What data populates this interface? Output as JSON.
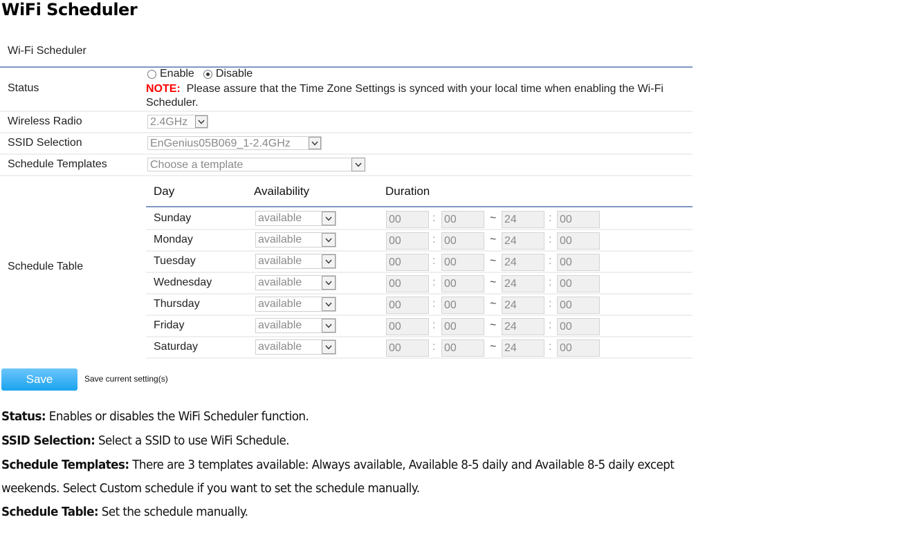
{
  "doc_title": "WiFi Scheduler",
  "panel": {
    "title": "Wi-Fi Scheduler",
    "status": {
      "label": "Status",
      "options": [
        {
          "label": "Enable",
          "checked": false
        },
        {
          "label": "Disable",
          "checked": true
        }
      ],
      "note_key": "NOTE:",
      "note_text": "Please assure that the Time Zone Settings is synced with your local time when enabling the Wi-Fi Scheduler."
    },
    "wireless_radio": {
      "label": "Wireless Radio",
      "value": "2.4GHz"
    },
    "ssid_selection": {
      "label": "SSID Selection",
      "value": "EnGenius05B069_1-2.4GHz"
    },
    "schedule_templates": {
      "label": "Schedule Templates",
      "value": "Choose a template"
    },
    "schedule_table": {
      "label": "Schedule Table",
      "headers": {
        "day": "Day",
        "availability": "Availability",
        "duration": "Duration"
      },
      "rows": [
        {
          "day": "Sunday",
          "availability": "available",
          "start_h": "00",
          "start_m": "00",
          "end_h": "24",
          "end_m": "00"
        },
        {
          "day": "Monday",
          "availability": "available",
          "start_h": "00",
          "start_m": "00",
          "end_h": "24",
          "end_m": "00"
        },
        {
          "day": "Tuesday",
          "availability": "available",
          "start_h": "00",
          "start_m": "00",
          "end_h": "24",
          "end_m": "00"
        },
        {
          "day": "Wednesday",
          "availability": "available",
          "start_h": "00",
          "start_m": "00",
          "end_h": "24",
          "end_m": "00"
        },
        {
          "day": "Thursday",
          "availability": "available",
          "start_h": "00",
          "start_m": "00",
          "end_h": "24",
          "end_m": "00"
        },
        {
          "day": "Friday",
          "availability": "available",
          "start_h": "00",
          "start_m": "00",
          "end_h": "24",
          "end_m": "00"
        },
        {
          "day": "Saturday",
          "availability": "available",
          "start_h": "00",
          "start_m": "00",
          "end_h": "24",
          "end_m": "00"
        }
      ],
      "colon": ":",
      "tilde": "~"
    },
    "save": {
      "label": "Save",
      "hint": "Save current setting(s)"
    }
  },
  "descriptions": [
    {
      "term": "Status:",
      "text": " Enables or disables the WiFi Scheduler function."
    },
    {
      "term": "SSID Selection:",
      "text": " Select a SSID to use WiFi Schedule."
    },
    {
      "term": "Schedule Templates:",
      "text": " There are 3 templates available: Always available, Available 8-5 daily and Available 8-5 daily except"
    },
    {
      "term": "",
      "text": "weekends. Select Custom schedule if you want to set the schedule manually."
    },
    {
      "term": "Schedule Table:",
      "text": " Set the schedule manually."
    }
  ],
  "colors": {
    "rule": "#7f97c2",
    "note": "#ff0000",
    "save_button": "#1aa3ee"
  }
}
